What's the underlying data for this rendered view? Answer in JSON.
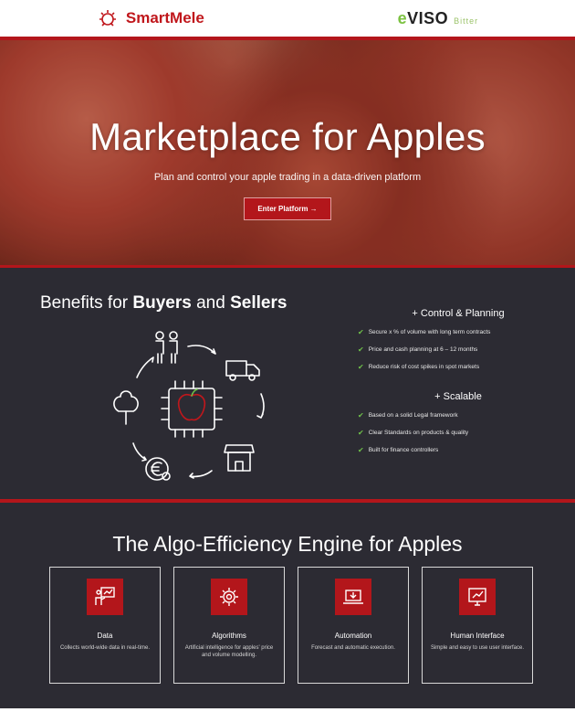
{
  "header": {
    "left_logo": "SmartMele",
    "right_logo_e": "e",
    "right_logo_rest": "VISO",
    "right_logo_sub": "Bitter"
  },
  "hero": {
    "title": "Marketplace for Apples",
    "subtitle": "Plan and control your apple trading in a data-driven platform",
    "button_label": "Enter Platform →"
  },
  "benefits": {
    "title_prefix": "Benefits for ",
    "title_buyers": "Buyers",
    "title_and": " and ",
    "title_sellers": "Sellers",
    "groups": [
      {
        "heading": "+ Control & Planning",
        "items": [
          "Secure x % of volume with long term contracts",
          "Price and cash planning at 6 – 12 months",
          "Reduce risk of cost spikes in spot markets"
        ]
      },
      {
        "heading": "+ Scalable",
        "items": [
          "Based on a solid Legal framework",
          "Clear Standards on products & quality",
          "Built for finance controllers"
        ]
      }
    ]
  },
  "engine": {
    "title": "The Algo-Efficiency Engine for Apples",
    "cards": [
      {
        "title": "Data",
        "desc": "Collects world-wide data in real-time.",
        "icon": "chart-board-icon"
      },
      {
        "title": "Algorithms",
        "desc": "Artificial intelligence for apples' price and volume modelling.",
        "icon": "gear-brain-icon"
      },
      {
        "title": "Automation",
        "desc": "Forecast and automatic execution.",
        "icon": "laptop-icon"
      },
      {
        "title": "Human Interface",
        "desc": "Simple and easy to use user interface.",
        "icon": "screen-chart-icon"
      }
    ]
  },
  "colors": {
    "brand_red": "#b3161b",
    "dark_bg": "#2c2b33",
    "check_green": "#6fc14a"
  }
}
